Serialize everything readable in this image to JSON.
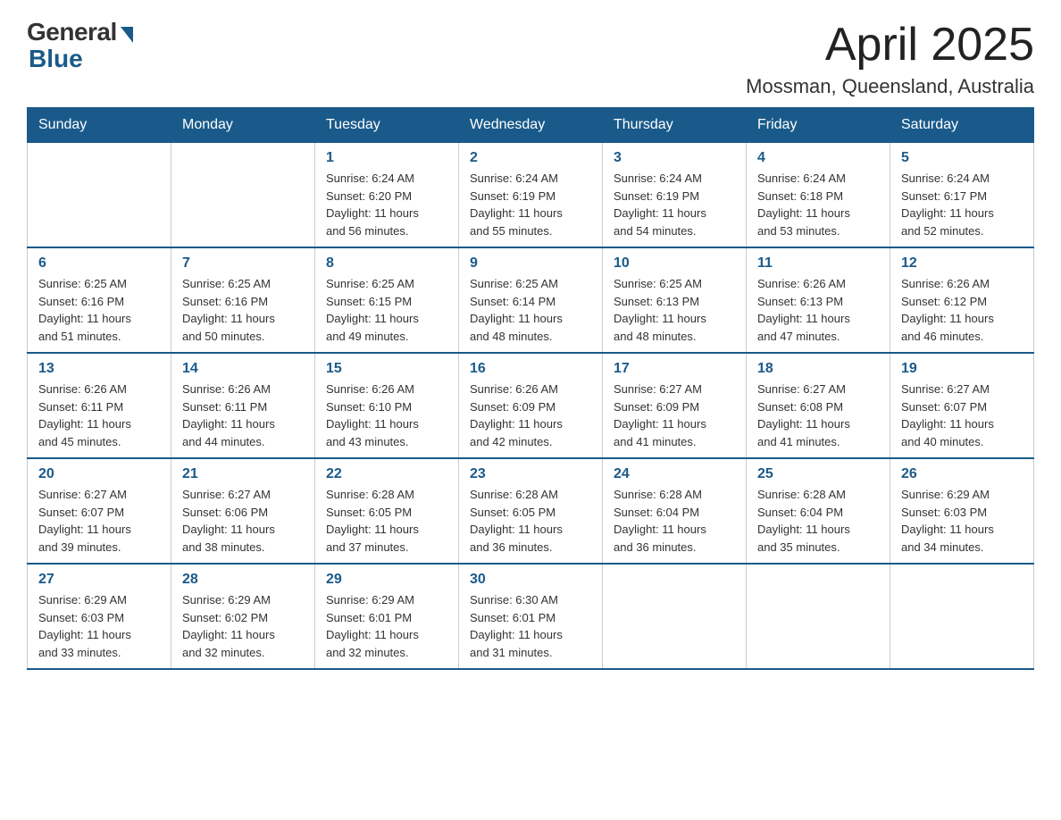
{
  "header": {
    "logo_general": "General",
    "logo_blue": "Blue",
    "title": "April 2025",
    "subtitle": "Mossman, Queensland, Australia"
  },
  "calendar": {
    "days_of_week": [
      "Sunday",
      "Monday",
      "Tuesday",
      "Wednesday",
      "Thursday",
      "Friday",
      "Saturday"
    ],
    "weeks": [
      [
        {
          "day": "",
          "info": ""
        },
        {
          "day": "",
          "info": ""
        },
        {
          "day": "1",
          "info": "Sunrise: 6:24 AM\nSunset: 6:20 PM\nDaylight: 11 hours\nand 56 minutes."
        },
        {
          "day": "2",
          "info": "Sunrise: 6:24 AM\nSunset: 6:19 PM\nDaylight: 11 hours\nand 55 minutes."
        },
        {
          "day": "3",
          "info": "Sunrise: 6:24 AM\nSunset: 6:19 PM\nDaylight: 11 hours\nand 54 minutes."
        },
        {
          "day": "4",
          "info": "Sunrise: 6:24 AM\nSunset: 6:18 PM\nDaylight: 11 hours\nand 53 minutes."
        },
        {
          "day": "5",
          "info": "Sunrise: 6:24 AM\nSunset: 6:17 PM\nDaylight: 11 hours\nand 52 minutes."
        }
      ],
      [
        {
          "day": "6",
          "info": "Sunrise: 6:25 AM\nSunset: 6:16 PM\nDaylight: 11 hours\nand 51 minutes."
        },
        {
          "day": "7",
          "info": "Sunrise: 6:25 AM\nSunset: 6:16 PM\nDaylight: 11 hours\nand 50 minutes."
        },
        {
          "day": "8",
          "info": "Sunrise: 6:25 AM\nSunset: 6:15 PM\nDaylight: 11 hours\nand 49 minutes."
        },
        {
          "day": "9",
          "info": "Sunrise: 6:25 AM\nSunset: 6:14 PM\nDaylight: 11 hours\nand 48 minutes."
        },
        {
          "day": "10",
          "info": "Sunrise: 6:25 AM\nSunset: 6:13 PM\nDaylight: 11 hours\nand 48 minutes."
        },
        {
          "day": "11",
          "info": "Sunrise: 6:26 AM\nSunset: 6:13 PM\nDaylight: 11 hours\nand 47 minutes."
        },
        {
          "day": "12",
          "info": "Sunrise: 6:26 AM\nSunset: 6:12 PM\nDaylight: 11 hours\nand 46 minutes."
        }
      ],
      [
        {
          "day": "13",
          "info": "Sunrise: 6:26 AM\nSunset: 6:11 PM\nDaylight: 11 hours\nand 45 minutes."
        },
        {
          "day": "14",
          "info": "Sunrise: 6:26 AM\nSunset: 6:11 PM\nDaylight: 11 hours\nand 44 minutes."
        },
        {
          "day": "15",
          "info": "Sunrise: 6:26 AM\nSunset: 6:10 PM\nDaylight: 11 hours\nand 43 minutes."
        },
        {
          "day": "16",
          "info": "Sunrise: 6:26 AM\nSunset: 6:09 PM\nDaylight: 11 hours\nand 42 minutes."
        },
        {
          "day": "17",
          "info": "Sunrise: 6:27 AM\nSunset: 6:09 PM\nDaylight: 11 hours\nand 41 minutes."
        },
        {
          "day": "18",
          "info": "Sunrise: 6:27 AM\nSunset: 6:08 PM\nDaylight: 11 hours\nand 41 minutes."
        },
        {
          "day": "19",
          "info": "Sunrise: 6:27 AM\nSunset: 6:07 PM\nDaylight: 11 hours\nand 40 minutes."
        }
      ],
      [
        {
          "day": "20",
          "info": "Sunrise: 6:27 AM\nSunset: 6:07 PM\nDaylight: 11 hours\nand 39 minutes."
        },
        {
          "day": "21",
          "info": "Sunrise: 6:27 AM\nSunset: 6:06 PM\nDaylight: 11 hours\nand 38 minutes."
        },
        {
          "day": "22",
          "info": "Sunrise: 6:28 AM\nSunset: 6:05 PM\nDaylight: 11 hours\nand 37 minutes."
        },
        {
          "day": "23",
          "info": "Sunrise: 6:28 AM\nSunset: 6:05 PM\nDaylight: 11 hours\nand 36 minutes."
        },
        {
          "day": "24",
          "info": "Sunrise: 6:28 AM\nSunset: 6:04 PM\nDaylight: 11 hours\nand 36 minutes."
        },
        {
          "day": "25",
          "info": "Sunrise: 6:28 AM\nSunset: 6:04 PM\nDaylight: 11 hours\nand 35 minutes."
        },
        {
          "day": "26",
          "info": "Sunrise: 6:29 AM\nSunset: 6:03 PM\nDaylight: 11 hours\nand 34 minutes."
        }
      ],
      [
        {
          "day": "27",
          "info": "Sunrise: 6:29 AM\nSunset: 6:03 PM\nDaylight: 11 hours\nand 33 minutes."
        },
        {
          "day": "28",
          "info": "Sunrise: 6:29 AM\nSunset: 6:02 PM\nDaylight: 11 hours\nand 32 minutes."
        },
        {
          "day": "29",
          "info": "Sunrise: 6:29 AM\nSunset: 6:01 PM\nDaylight: 11 hours\nand 32 minutes."
        },
        {
          "day": "30",
          "info": "Sunrise: 6:30 AM\nSunset: 6:01 PM\nDaylight: 11 hours\nand 31 minutes."
        },
        {
          "day": "",
          "info": ""
        },
        {
          "day": "",
          "info": ""
        },
        {
          "day": "",
          "info": ""
        }
      ]
    ]
  }
}
